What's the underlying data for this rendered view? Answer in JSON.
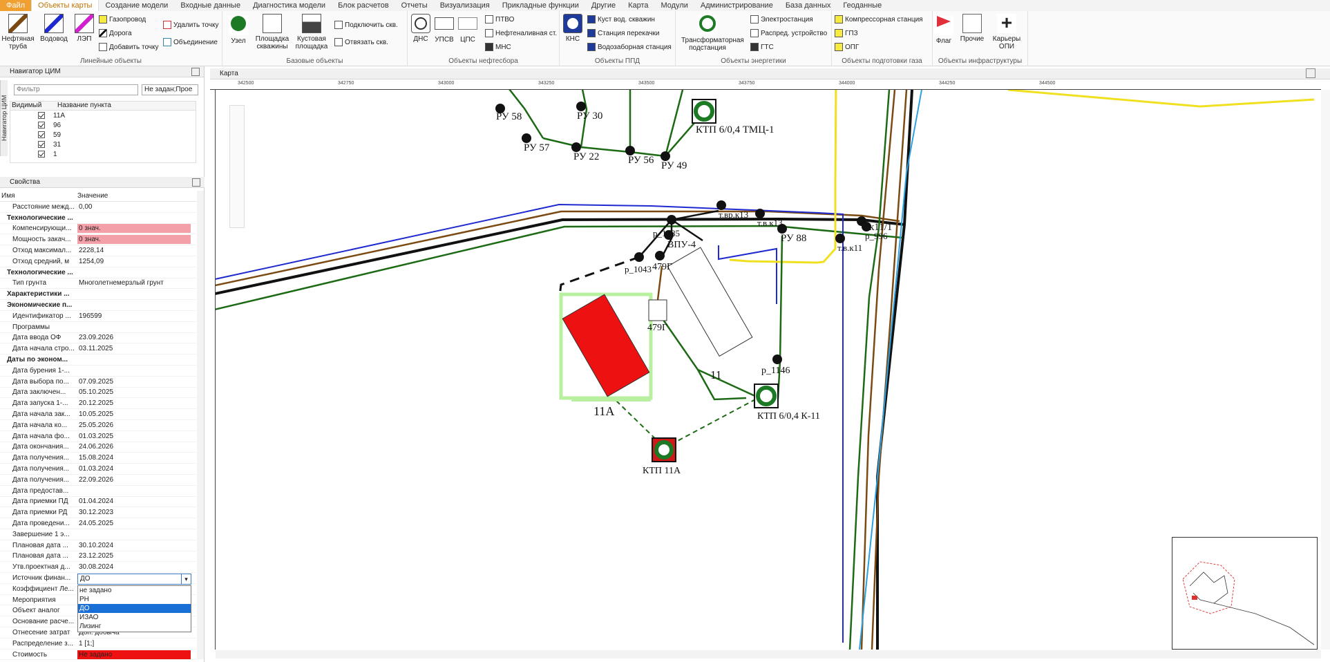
{
  "menu": [
    "Файл",
    "Объекты карты",
    "Создание модели",
    "Входные данные",
    "Диагностика модели",
    "Блок расчетов",
    "Отчеты",
    "Визуализация",
    "Прикладные функции",
    "Другие",
    "Карта",
    "Модули",
    "Администрирование",
    "База данных",
    "Геоданные"
  ],
  "ribbon": {
    "linear": {
      "label": "Линейные объекты",
      "big": [
        "Нефтяная труба",
        "Водовод",
        "ЛЭП"
      ],
      "small": [
        "Газопровод",
        "Дорога",
        "Добавить точку",
        "Удалить точку",
        "Объединение"
      ]
    },
    "base": {
      "label": "Базовые объекты",
      "big": [
        "Узел",
        "Площадка скважины",
        "Кустовая площадка"
      ],
      "small": [
        "Подключить скв.",
        "Отвязать скв."
      ]
    },
    "oil": {
      "label": "Объекты нефтесбора",
      "big": [
        "ДНС",
        "УПСВ",
        "ЦПС"
      ],
      "small": [
        "ПТВО",
        "Нефтеналивная ст.",
        "МНС"
      ]
    },
    "ppd": {
      "label": "Объекты ППД",
      "big": [
        "КНС"
      ],
      "small": [
        "Куст вод. скважин",
        "Станция перекачки",
        "Водозаборная станция"
      ]
    },
    "energy": {
      "label": "Объекты энергетики",
      "big": [
        "Трансформаторная подстанция"
      ],
      "small": [
        "Электростанция",
        "Распред. устройство",
        "ГТС"
      ]
    },
    "gas": {
      "label": "Объекты подготовки газа",
      "small": [
        "Компрессорная станция",
        "ГПЗ",
        "ОПГ"
      ]
    },
    "infra": {
      "label": "Объекты инфраструктуры",
      "big": [
        "Флаг",
        "Прочие",
        "Карьеры ОПИ"
      ]
    }
  },
  "navigator": {
    "title": "Навигатор ЦИМ",
    "vtab": "Навигатор ЦИМ",
    "filter_placeholder": "Фильтр",
    "filter_select": "Не задан;Прое",
    "col_visible": "Видимый",
    "col_name": "Название пункта",
    "rows": [
      "11А",
      "96",
      "59",
      "31",
      "1"
    ]
  },
  "properties": {
    "title": "Свойства",
    "col_name": "Имя",
    "col_value": "Значение",
    "rows": [
      {
        "n": "Расстояние межд...",
        "v": "0,00"
      },
      {
        "n": "Технологические ...",
        "v": "",
        "bold": true
      },
      {
        "n": "Компенсирующи...",
        "v": "0 знач.",
        "style": "pink"
      },
      {
        "n": "Мощность закач...",
        "v": "0 знач.",
        "style": "pink"
      },
      {
        "n": "Отход максимал...",
        "v": "2228,14"
      },
      {
        "n": "Отход средний, м",
        "v": "1254,09"
      },
      {
        "n": "Технологические ...",
        "v": "",
        "bold": true
      },
      {
        "n": "Тип грунта",
        "v": "Многолетнемерзлый грунт"
      },
      {
        "n": "Характеристики ...",
        "v": "",
        "bold": true
      },
      {
        "n": "Экономические п...",
        "v": "",
        "bold": true
      },
      {
        "n": "Идентификатор ...",
        "v": "196599"
      },
      {
        "n": "Программы",
        "v": ""
      },
      {
        "n": "Дата ввода ОФ",
        "v": "23.09.2026"
      },
      {
        "n": "Дата начала стро...",
        "v": "03.11.2025"
      },
      {
        "n": "Даты по эконом...",
        "v": "",
        "bold": true
      },
      {
        "n": "Дата бурения 1-...",
        "v": ""
      },
      {
        "n": "Дата выбора по...",
        "v": "07.09.2025"
      },
      {
        "n": "Дата заключен...",
        "v": "05.10.2025"
      },
      {
        "n": "Дата запуска 1-...",
        "v": "20.12.2025"
      },
      {
        "n": "Дата начала зак...",
        "v": "10.05.2025"
      },
      {
        "n": "Дата начала ко...",
        "v": "25.05.2026"
      },
      {
        "n": "Дата начала фо...",
        "v": "01.03.2025"
      },
      {
        "n": "Дата окончания...",
        "v": "24.06.2026"
      },
      {
        "n": "Дата получения...",
        "v": "15.08.2024"
      },
      {
        "n": "Дата получения...",
        "v": "01.03.2024"
      },
      {
        "n": "Дата получения...",
        "v": "22.09.2026"
      },
      {
        "n": "Дата предостав...",
        "v": ""
      },
      {
        "n": "Дата приемки ПД",
        "v": "01.04.2024"
      },
      {
        "n": "Дата приемки РД",
        "v": "30.12.2023"
      },
      {
        "n": "Дата проведени...",
        "v": "24.05.2025"
      },
      {
        "n": "Завершение 1 э...",
        "v": ""
      },
      {
        "n": "Плановая дата ...",
        "v": "30.10.2024"
      },
      {
        "n": "Плановая дата ...",
        "v": "23.12.2025"
      },
      {
        "n": "Утв.проектная д...",
        "v": "30.08.2024"
      },
      {
        "n": "Источник финан...",
        "v": "ДО"
      },
      {
        "n": "Коэффициент Ле...",
        "v": ""
      },
      {
        "n": "Мероприятия",
        "v": ""
      },
      {
        "n": "Объект аналог",
        "v": ""
      },
      {
        "n": "Основание расче...",
        "v": ""
      },
      {
        "n": "Отнесение затрат",
        "v": "Доп. добыча"
      },
      {
        "n": "Распределение з...",
        "v": "1 [1;]"
      },
      {
        "n": "Стоимость",
        "v": "Не задано",
        "style": "red"
      }
    ],
    "dropdown_value": "ДО",
    "dropdown_options": [
      "не задано",
      "РН",
      "ДО",
      "ИЗАО",
      "Лизинг"
    ],
    "dropdown_selected": "ДО"
  },
  "map": {
    "title": "Карта",
    "ruler_ticks": [
      "342500",
      "342750",
      "343000",
      "343250",
      "343500",
      "343750",
      "344000",
      "344250",
      "344500"
    ],
    "labels": {
      "ru58": "РУ 58",
      "ru57": "РУ 57",
      "ru30": "РУ 30",
      "ru22": "РУ 22",
      "ru56": "РУ 56",
      "ru49": "РУ 49",
      "ktp_top": "КТП 6/0,4  ТМЦ-1",
      "tvrk13": "т.вр.к13",
      "tvk13": "т.в.к13",
      "k11_1": "к11/1",
      "p996": "р_996",
      "ru88": "РУ 88",
      "tvk11": "т.в.к11",
      "p1085": "р_1085",
      "vpu4": "ВПУ-4",
      "p1043": "р_1043",
      "g479a": "479Г",
      "g479b": "479Г",
      "n11": "11",
      "p1146": "р_1146",
      "ktp_k11": "КТП 6/0,4  К-11",
      "pad11a": "11А",
      "ktp11a": "КТП 11А"
    },
    "colors": {
      "oil": "#7a4a12",
      "water": "#1e2ad0",
      "power": "#1c6a14",
      "gas": "#f0e020",
      "road": "#111111",
      "pad_fill": "#ee1111",
      "pad_border": "#b8f0a0",
      "substation": "#1c7a24"
    }
  }
}
